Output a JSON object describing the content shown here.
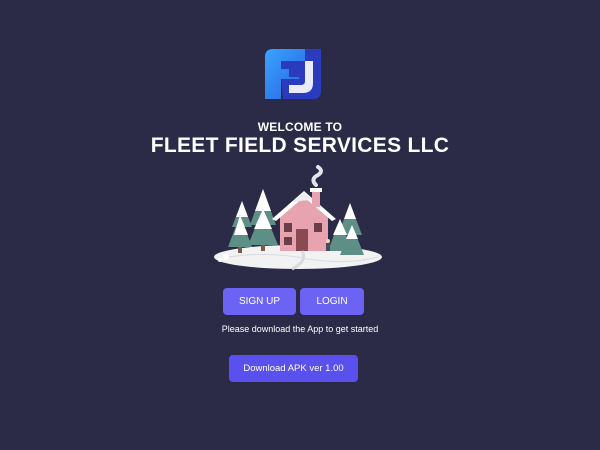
{
  "colors": {
    "background": "#2b2a47",
    "button": "#6c63f5",
    "download_button": "#5a50ee",
    "logo_light": "#2f8cf0",
    "logo_dark": "#2a3bbd"
  },
  "logo": {
    "icon": "fleet-field-logo-icon"
  },
  "header": {
    "welcome": "WELCOME TO",
    "company": "FLEET FIELD SERVICES LLC"
  },
  "illustration": {
    "icon": "snowy-house-illustration"
  },
  "actions": {
    "signup_label": "SIGN UP",
    "login_label": "LOGIN"
  },
  "info_text": "Please download the App to get started",
  "download": {
    "label": "Download APK ver 1.00"
  }
}
